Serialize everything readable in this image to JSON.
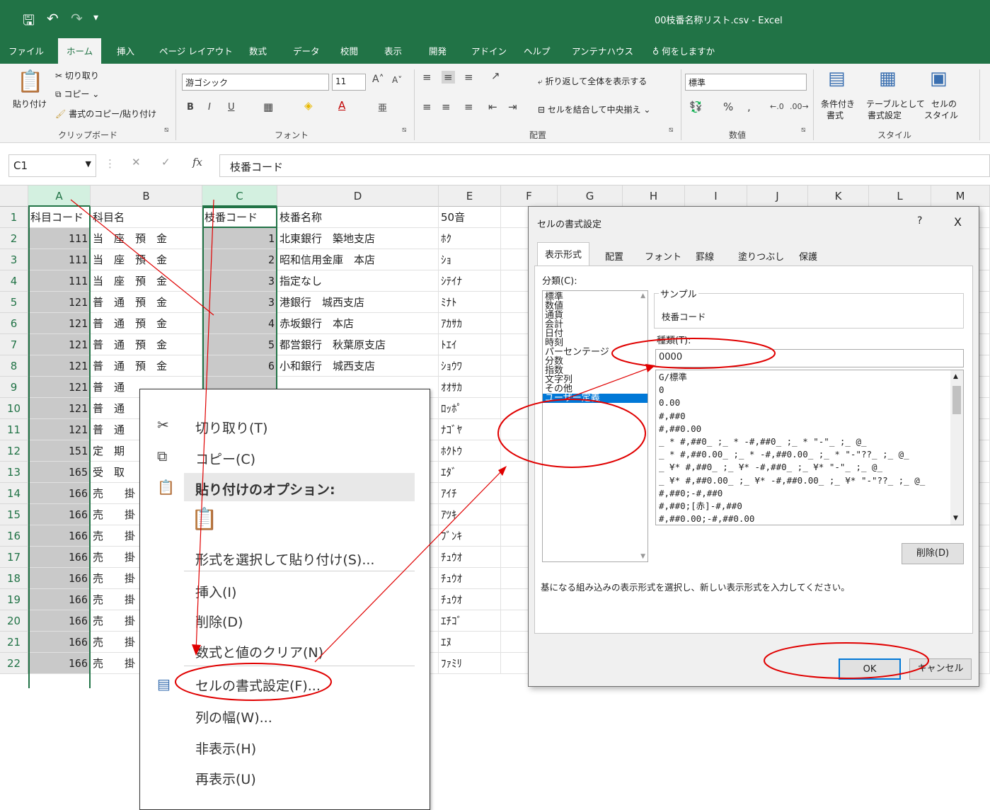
{
  "app": {
    "title": "00枝番名称リスト.csv  -  Excel"
  },
  "tabs": [
    "ファイル",
    "ホーム",
    "挿入",
    "ページ レイアウト",
    "数式",
    "データ",
    "校閲",
    "表示",
    "開発",
    "アドイン",
    "ヘルプ",
    "アンテナハウス",
    "何をしますか"
  ],
  "ribbon": {
    "paste": "貼り付け",
    "cut": "切り取り",
    "copy": "コピー",
    "format_painter": "書式のコピー/貼り付け",
    "clipboard_group": "クリップボード",
    "font_name": "游ゴシック",
    "font_size": "11",
    "font_group": "フォント",
    "wrap_text": "折り返して全体を表示する",
    "merge_center": "セルを結合して中央揃え",
    "align_group": "配置",
    "number_format": "標準",
    "number_group": "数値",
    "cond_format": "条件付き",
    "cond_format2": "書式",
    "table_format": "テーブルとして",
    "table_format2": "書式設定",
    "cell_style": "セルの",
    "cell_style2": "スタイル",
    "style_group": "スタイル"
  },
  "formula_bar": {
    "name_box": "C1",
    "fx": "fx",
    "content": "枝番コード"
  },
  "columns": [
    "A",
    "B",
    "C",
    "D",
    "E",
    "F",
    "G",
    "H",
    "I",
    "J",
    "K",
    "L",
    "M"
  ],
  "rows": [
    {
      "n": "1",
      "a": "科目コード",
      "b": "科目名",
      "c": "枝番コード",
      "d": "枝番名称",
      "e": "50音"
    },
    {
      "n": "2",
      "a": "111",
      "b": "当　座　預　金",
      "c": "1",
      "d": "北東銀行　築地支店",
      "e": "ﾎｸ"
    },
    {
      "n": "3",
      "a": "111",
      "b": "当　座　預　金",
      "c": "2",
      "d": "昭和信用金庫　本店",
      "e": "ｼｮ"
    },
    {
      "n": "4",
      "a": "111",
      "b": "当　座　預　金",
      "c": "3",
      "d": "指定なし",
      "e": "ｼﾃｲﾅ"
    },
    {
      "n": "5",
      "a": "121",
      "b": "普　通　預　金",
      "c": "3",
      "d": "港銀行　城西支店",
      "e": "ﾐﾅﾄ"
    },
    {
      "n": "6",
      "a": "121",
      "b": "普　通　預　金",
      "c": "4",
      "d": "赤坂銀行　本店",
      "e": "ｱｶｻｶ"
    },
    {
      "n": "7",
      "a": "121",
      "b": "普　通　預　金",
      "c": "5",
      "d": "都営銀行　秋葉原支店",
      "e": "ﾄｴｲ"
    },
    {
      "n": "8",
      "a": "121",
      "b": "普　通　預　金",
      "c": "6",
      "d": "小和銀行　城西支店",
      "e": "ｼｮｳﾜ"
    },
    {
      "n": "9",
      "a": "121",
      "b": "普　通",
      "c": "",
      "d": "",
      "e": "ｵｵｻｶ"
    },
    {
      "n": "10",
      "a": "121",
      "b": "普　通",
      "c": "",
      "d": "",
      "e": "ﾛｯﾎﾟ"
    },
    {
      "n": "11",
      "a": "121",
      "b": "普　通",
      "c": "",
      "d": "",
      "e": "ﾅｺﾞﾔ"
    },
    {
      "n": "12",
      "a": "151",
      "b": "定　期",
      "c": "",
      "d": "",
      "e": "ﾎｸﾄｳ"
    },
    {
      "n": "13",
      "a": "165",
      "b": "受　取",
      "c": "",
      "d": "",
      "e": "ｴﾀﾞ"
    },
    {
      "n": "14",
      "a": "166",
      "b": "売　　掛",
      "c": "",
      "d": "",
      "e": "ｱｲﾁ"
    },
    {
      "n": "15",
      "a": "166",
      "b": "売　　掛",
      "c": "",
      "d": "",
      "e": "ｱﾂｷ"
    },
    {
      "n": "16",
      "a": "166",
      "b": "売　　掛",
      "c": "",
      "d": "",
      "e": "ﾌﾞﾝｷ"
    },
    {
      "n": "17",
      "a": "166",
      "b": "売　　掛",
      "c": "",
      "d": "",
      "e": "ﾁｭｳｵ"
    },
    {
      "n": "18",
      "a": "166",
      "b": "売　　掛",
      "c": "",
      "d": "",
      "e": "ﾁｭｳｵ"
    },
    {
      "n": "19",
      "a": "166",
      "b": "売　　掛",
      "c": "",
      "d": "",
      "e": "ﾁｭｳｵ"
    },
    {
      "n": "20",
      "a": "166",
      "b": "売　　掛",
      "c": "",
      "d": "",
      "e": "ｴﾁｺﾞ"
    },
    {
      "n": "21",
      "a": "166",
      "b": "売　　掛",
      "c": "",
      "d": "",
      "e": "ｴﾇ"
    },
    {
      "n": "22",
      "a": "166",
      "b": "売　　掛",
      "c": "",
      "d": "",
      "e": "ﾌｧﾐﾘ"
    }
  ],
  "context_menu": {
    "cut": "切り取り(T)",
    "copy": "コピー(C)",
    "paste_options": "貼り付けのオプション:",
    "paste_special": "形式を選択して貼り付け(S)...",
    "insert": "挿入(I)",
    "delete": "削除(D)",
    "clear": "数式と値のクリア(N)",
    "format_cells": "セルの書式設定(F)...",
    "col_width": "列の幅(W)...",
    "hide": "非表示(H)",
    "unhide": "再表示(U)"
  },
  "dialog": {
    "title": "セルの書式設定",
    "help": "?",
    "close": "X",
    "tabs": [
      "表示形式",
      "配置",
      "フォント",
      "罫線",
      "塗りつぶし",
      "保護"
    ],
    "category_label": "分類(C):",
    "categories": [
      "標準",
      "数値",
      "通貨",
      "会計",
      "日付",
      "時刻",
      "パーセンテージ",
      "分数",
      "指数",
      "文字列",
      "その他",
      "ユーザー定義"
    ],
    "selected_category": "ユーザー定義",
    "sample_label": "サンプル",
    "sample_value": "枝番コード",
    "type_label": "種類(T):",
    "type_value": "0000",
    "formats": [
      "G/標準",
      "0",
      "0.00",
      "#,##0",
      "#,##0.00",
      "_ * #,##0_ ;_ * -#,##0_ ;_ * \"-\"_ ;_ @_",
      "_ * #,##0.00_ ;_ * -#,##0.00_ ;_ * \"-\"??_ ;_ @_",
      "_ ¥* #,##0_ ;_ ¥* -#,##0_ ;_ ¥* \"-\"_ ;_ @_",
      "_ ¥* #,##0.00_ ;_ ¥* -#,##0.00_ ;_ ¥* \"-\"??_ ;_ @_",
      "#,##0;-#,##0",
      "#,##0;[赤]-#,##0",
      "#,##0.00;-#,##0.00"
    ],
    "delete_button": "削除(D)",
    "hint": "基になる組み込みの表示形式を選択し、新しい表示形式を入力してください。",
    "ok": "OK",
    "cancel": "キャンセル"
  },
  "colors": {
    "excel_green": "#217346",
    "annotation": "#e00000",
    "selection_blue": "#0078d7"
  }
}
